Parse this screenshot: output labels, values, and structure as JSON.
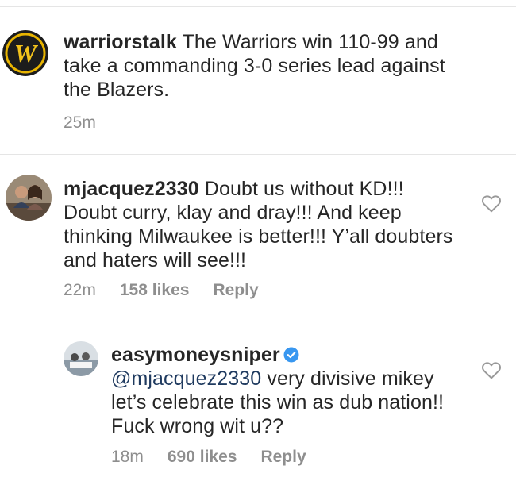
{
  "post": {
    "username": "warriorstalk",
    "caption": "The Warriors win 110-99 and take a commanding 3-0 series lead against the Blazers.",
    "time": "25m",
    "avatar_letter": "W"
  },
  "comments": [
    {
      "username": "mjacquez2330",
      "text": "Doubt us without KD!!! Doubt curry, klay and dray!!! And keep thinking Milwaukee is better!!! Y’all doubters and haters will see!!!",
      "time": "22m",
      "likes": "158 likes",
      "reply_label": "Reply"
    }
  ],
  "reply": {
    "username": "easymoneysniper",
    "verified": true,
    "mention": "@mjacquez2330",
    "text": "very divisive mikey let’s celebrate this win as dub nation!! Fuck wrong wit u??",
    "time": "18m",
    "likes": "690 likes",
    "reply_label": "Reply"
  },
  "colors": {
    "logo_background": "#1c1c1c",
    "logo_ring": "#e8b400",
    "logo_letter": "#f2c21b",
    "secondary_text": "#8e8e8e",
    "verified_badge": "#3897f0"
  },
  "icons": {
    "like": "heart-outline-icon",
    "verified": "verified-badge-icon"
  }
}
